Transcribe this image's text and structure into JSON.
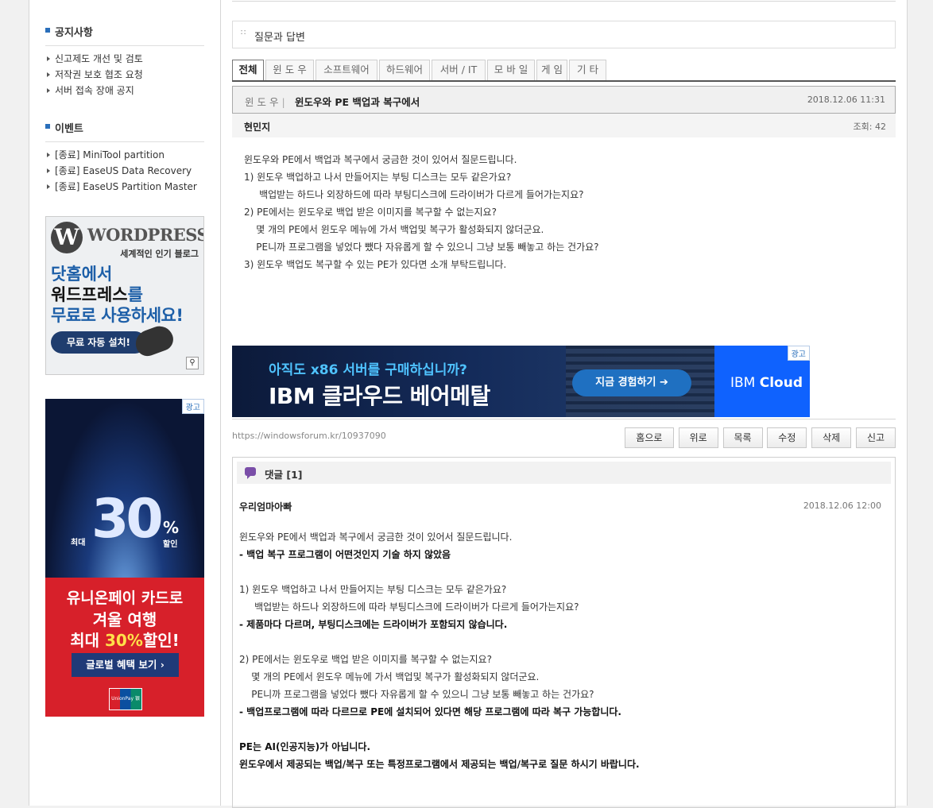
{
  "sidebar": {
    "notice_title": "공지사항",
    "notices": [
      "신고제도 개선 및 검토",
      "저작권 보호 협조 요청",
      "서버 접속 장애 공지"
    ],
    "event_title": "이벤트",
    "events": [
      "[종료] MiniTool partition",
      "[종료] EaseUS Data Recovery",
      "[종료] EaseUS Partition Master"
    ],
    "ad_wordpress": {
      "logo": "WORDPRESS",
      "tagline": "세계적인 인기 블로그",
      "line1": "닷홈에서",
      "line2a": "워드프레스",
      "line2b": "를",
      "line3": "무료로 사용하세요!",
      "button": "무료 자동 설치!"
    },
    "ad_unionpay": {
      "tag": "광고",
      "discount_prefix": "최대",
      "discount_number": "30",
      "discount_suffix": "%",
      "discount_word": "할인",
      "line1": "유니온페이 카드로",
      "line2": "겨울 여행",
      "line3a": "최대 ",
      "line3b": "30%",
      "line3c": "할인!",
      "button": "글로벌 혜택 보기",
      "brand": "UnionPay 银联"
    }
  },
  "section_title": "질문과 답변",
  "tabs": [
    "전체",
    "윈 도 우",
    "소프트웨어",
    "하드웨어",
    "서버 / IT",
    "모 바 일",
    "게 임",
    "기 타"
  ],
  "post": {
    "category": "윈 도 우",
    "separator": "|",
    "title": "윈도우와 PE 백업과 복구에서",
    "date": "2018.12.06 11:31",
    "author": "현민지",
    "views": "조회: 42",
    "body": [
      "윈도우와 PE에서 백업과 복구에서 궁금한 것이 있어서 질문드립니다.",
      "",
      "1) 윈도우 백업하고 나서 만들어지는 부팅 디스크는 모두 같은가요?",
      "     백업받는 하드나 외장하드에 따라 부팅디스크에 드라이버가 다르게 들어가는지요?",
      "",
      "2) PE에서는 윈도우로 백업 받은 이미지를 복구할 수 없는지요?",
      "    몇 개의 PE에서 윈도우 메뉴에 가서 백업및 복구가 활성화되지 않더군요.",
      "    PE니까 프로그램을 넣었다 뺐다 자유롭게 할 수 있으니 그냥 보통 빼놓고 하는 건가요?",
      "",
      "3) 윈도우 백업도 복구할 수 있는 PE가 있다면 소개 부탁드립니다."
    ]
  },
  "banner": {
    "tag": "광고",
    "headline": "아직도 x86 서버를 구매하십니까?",
    "main": "IBM 클라우드 베어메탈",
    "cta": "지금 경험하기",
    "brand_a": "IBM ",
    "brand_b": "Cloud"
  },
  "url": "https://windowsforum.kr/10937090",
  "actions": [
    "홈으로",
    "위로",
    "목록",
    "수정",
    "삭제",
    "신고"
  ],
  "comments": {
    "title": "댓글 [1]",
    "author": "우리엄마아빠",
    "date": "2018.12.06 12:00",
    "lines": [
      {
        "text": "윈도우와 PE에서 백업과 복구에서 궁금한 것이 있어서 질문드립니다.",
        "bold": false
      },
      {
        "text": "- 백업 복구 프로그램이 어떤것인지 기술 하지 않았음",
        "bold": true
      },
      {
        "text": "",
        "bold": false
      },
      {
        "text": "1) 윈도우 백업하고 나서 만들어지는 부팅 디스크는 모두 같은가요?",
        "bold": false
      },
      {
        "text": "     백업받는 하드나 외장하드에 따라 부팅디스크에 드라이버가 다르게 들어가는지요?",
        "bold": false
      },
      {
        "text": "- 제품마다 다르며, 부팅디스크에는 드라이버가 포함되지 않습니다.",
        "bold": true
      },
      {
        "text": "",
        "bold": false
      },
      {
        "text": "2) PE에서는 윈도우로 백업 받은 이미지를 복구할 수 없는지요?",
        "bold": false
      },
      {
        "text": "    몇 개의 PE에서 윈도우 메뉴에 가서 백업및 복구가 활성화되지 않더군요.",
        "bold": false
      },
      {
        "text": "    PE니까 프로그램을 넣었다 뺐다 자유롭게 할 수 있으니 그냥 보통 빼놓고 하는 건가요?",
        "bold": false
      },
      {
        "text": "- 백업프로그램에 따라 다르므로 PE에 설치되어 있다면 해당 프로그램에 따라 복구 가능합니다.",
        "bold": true
      },
      {
        "text": "",
        "bold": false
      },
      {
        "text": "PE는 AI(인공지능)가 아닙니다.",
        "bold": true
      },
      {
        "text": "윈도우에서 제공되는 백업/복구 또는 특정프로그램에서 제공되는 백업/복구로 질문 하시기 바랍니다.",
        "bold": true
      }
    ]
  },
  "colors": {
    "accent": "#2a6fbb",
    "cta_blue": "#1f70c1",
    "ibm_blue": "#0f62fe",
    "unionpay_red": "#d7202a"
  }
}
